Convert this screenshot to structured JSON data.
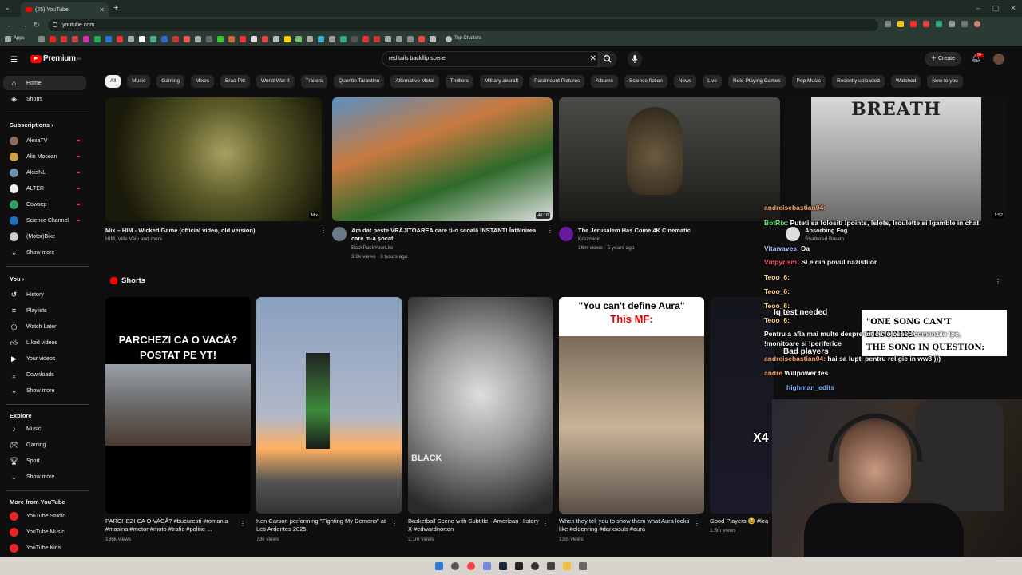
{
  "browser": {
    "tab_title": "(25) YouTube",
    "address": "youtube.com",
    "bookmarks": {
      "apps_label": "Apps",
      "top_chatters_label": "Top Chatters"
    }
  },
  "header": {
    "logo_text": "Premium",
    "logo_region": "RO",
    "search_query": "red tails backflip scene",
    "create_label": "Create",
    "notif_count": "9+"
  },
  "sidebar": {
    "home": "Home",
    "shorts": "Shorts",
    "subscriptions_heading": "Subscriptions",
    "subscriptions": [
      {
        "name": "AlexaTV",
        "color": "#8a6b55"
      },
      {
        "name": "Alin Mocean",
        "color": "#d0a040"
      },
      {
        "name": "AloisNL",
        "color": "#7090b0"
      },
      {
        "name": "ALTER",
        "color": "#eeeeee"
      },
      {
        "name": "Cowsep",
        "color": "#30a060"
      },
      {
        "name": "Science Channel",
        "color": "#2070c0"
      },
      {
        "name": "(Motor)Bike",
        "color": "#cccccc"
      }
    ],
    "show_more": "Show more",
    "you_heading": "You",
    "you_items": [
      "History",
      "Playlists",
      "Watch Later",
      "Liked videos",
      "Your videos",
      "Downloads",
      "Show more"
    ],
    "explore_heading": "Explore",
    "explore_items": [
      "Music",
      "Gaming",
      "Sport",
      "Show more"
    ],
    "more_heading": "More from YouTube",
    "more_items": [
      "YouTube Studio",
      "YouTube Music",
      "YouTube Kids"
    ]
  },
  "chips": [
    "All",
    "Music",
    "Gaming",
    "Mixes",
    "Brad Pitt",
    "World War II",
    "Trailers",
    "Quentin Tarantino",
    "Alternative Metal",
    "Thrillers",
    "Military aircraft",
    "Paramount Pictures",
    "Albums",
    "Science fiction",
    "News",
    "Live",
    "Role-Playing Games",
    "Pop Music",
    "Recently uploaded",
    "Watched",
    "New to you"
  ],
  "videos": [
    {
      "title": "Mix – HIM - Wicked Game (official video, old version)",
      "channel": "HIM, Ville Valo and more",
      "meta": "",
      "duration": "Mix"
    },
    {
      "title": "Am dat peste VRĂJITOAREA care ți-o scoală INSTANT! Întâlnirea care m-a șocat",
      "channel": "BackPackYourLife",
      "meta": "3.9k views · 3 hours ago",
      "duration": "40:18"
    },
    {
      "title": "The Jerusalem Has Come 4K Cinematic",
      "channel": "Krezmick",
      "meta": "16m views · 5 years ago",
      "duration": ""
    },
    {
      "title": "Absorbing Fog",
      "channel": "Shattered Breath",
      "meta": "",
      "duration": "1:52",
      "thumb_text": "BREATH"
    }
  ],
  "shorts_heading": "Shorts",
  "shorts": [
    {
      "title": "PARCHEZI CA O VACĂ? #bucuresti #romania #masina #motor #moto #trafic #politie ...",
      "views": "186k views",
      "caption": "PARCHEZI CA O VACĂ? POSTAT PE YT!"
    },
    {
      "title": "Ken Carson performing \"Fighting My Demons\" at Les Ardentes 2025.",
      "views": "73k views",
      "caption": ""
    },
    {
      "title": "Basketball Scene with Subtitle - American History X #edwardnorton",
      "views": "2.1m views",
      "caption": "BLACK"
    },
    {
      "title": "When they tell you to show them what Aura looks like #eldenring #darksouls #aura",
      "views": "13m views",
      "caption1": "\"You can't define Aura\"",
      "caption2": "This MF:"
    },
    {
      "title": "Good Players 😂 #lea",
      "views": "1.5m views",
      "caption": ""
    }
  ],
  "chat": [
    {
      "user": "andreisebastian04:",
      "msg": ""
    },
    {
      "user": "BotRix:",
      "msg": "Puteti sa folositi !points, !slots, !roulette si !gamble in chat"
    },
    {
      "user": "Vitawaves:",
      "msg": "Da"
    },
    {
      "user": "Vmpyrism:",
      "msg": "Si e din povul nazistilor"
    },
    {
      "user": "Teoo_6:",
      "msg": ""
    },
    {
      "user": "Teoo_6:",
      "msg": ""
    },
    {
      "user": "Teoo_6:",
      "msg": ""
    },
    {
      "user": "Teoo_6:",
      "msg": ""
    },
    {
      "user": "Iq test needed",
      "msg": ""
    },
    {
      "user": "",
      "msg": "Pentru a afla mai multe despre tot ce folosesc comenzile !pc, !monitoare si !periferice"
    },
    {
      "user": "andreisebastian04:",
      "msg": "hai sa lupti pentru religie in ww3 )))"
    },
    {
      "user": "andre",
      "msg": "Willpower tes"
    },
    {
      "user": "highman_edits",
      "msg": ""
    },
    {
      "user": "Bad players",
      "msg": ""
    }
  ],
  "overlay_text": {
    "song_box": "\"ONE SONG CAN'T DESCRIBE",
    "song_box2": "THE SONG IN QUESTION:",
    "mult": "X4"
  }
}
